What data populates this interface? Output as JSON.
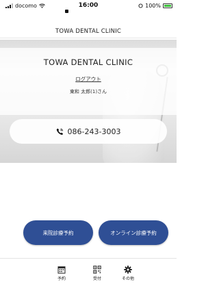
{
  "status_bar": {
    "carrier": "docomo",
    "time": "16:00",
    "battery": "100%"
  },
  "header": {
    "title": "TOWA DENTAL CLINIC"
  },
  "hero": {
    "clinic_name": "TOWA DENTAL CLINIC",
    "logout_label": "ログアウト",
    "user_name": "東和 太郎(1)さん",
    "phone": "086-243-3003"
  },
  "actions": {
    "visit_reservation": "来院診療予約",
    "online_reservation": "オンライン診療予約"
  },
  "tabbar": {
    "items": [
      {
        "label": "予約",
        "icon": "calendar-icon"
      },
      {
        "label": "受付",
        "icon": "qr-code-icon"
      },
      {
        "label": "その他",
        "icon": "gear-icon"
      }
    ]
  },
  "colors": {
    "button": "#2f4f95",
    "battery": "#3cc13b"
  }
}
